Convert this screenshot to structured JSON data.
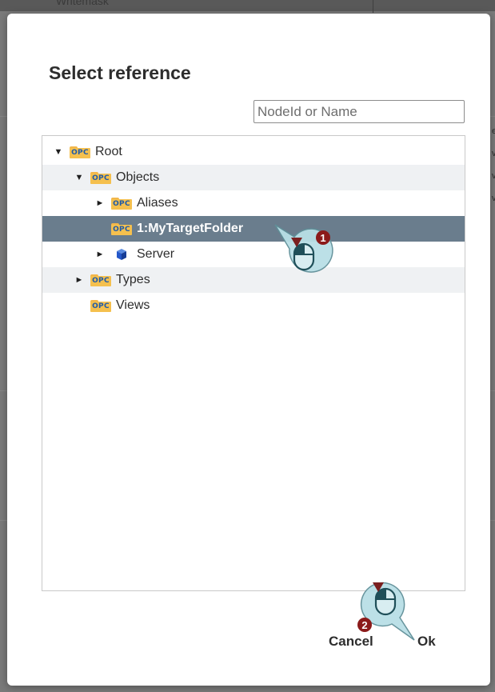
{
  "background": {
    "top_label": "Writemask",
    "right_edge_fragments": [
      "e",
      "v",
      "v",
      "v"
    ]
  },
  "dialog": {
    "title": "Select reference",
    "search": {
      "placeholder": "NodeId or Name",
      "value": ""
    },
    "tree": [
      {
        "label": "Root",
        "indent": 0,
        "toggle": "▼",
        "icon": "opc-folder-icon",
        "state": "normal"
      },
      {
        "label": "Objects",
        "indent": 1,
        "toggle": "▼",
        "icon": "opc-folder-icon",
        "state": "alt"
      },
      {
        "label": "Aliases",
        "indent": 2,
        "toggle": "►",
        "icon": "opc-folder-icon",
        "state": "normal"
      },
      {
        "label": "1:MyTargetFolder",
        "indent": 2,
        "toggle": "",
        "icon": "opc-folder-icon",
        "state": "selected"
      },
      {
        "label": "Server",
        "indent": 2,
        "toggle": "►",
        "icon": "server-cube-icon",
        "state": "normal"
      },
      {
        "label": "Types",
        "indent": 1,
        "toggle": "►",
        "icon": "opc-folder-icon",
        "state": "alt"
      },
      {
        "label": "Views",
        "indent": 1,
        "toggle": "",
        "icon": "opc-folder-icon",
        "state": "normal"
      }
    ],
    "opc_icon_text": "OPC",
    "buttons": {
      "cancel": "Cancel",
      "ok": "Ok"
    }
  },
  "annotations": {
    "step1": "1",
    "step2": "2"
  },
  "colors": {
    "selected_row": "#6a7d8d",
    "alt_row": "#eff1f3",
    "callout_fill": "#a9d7e0",
    "step_badge": "#8b1a1a"
  }
}
